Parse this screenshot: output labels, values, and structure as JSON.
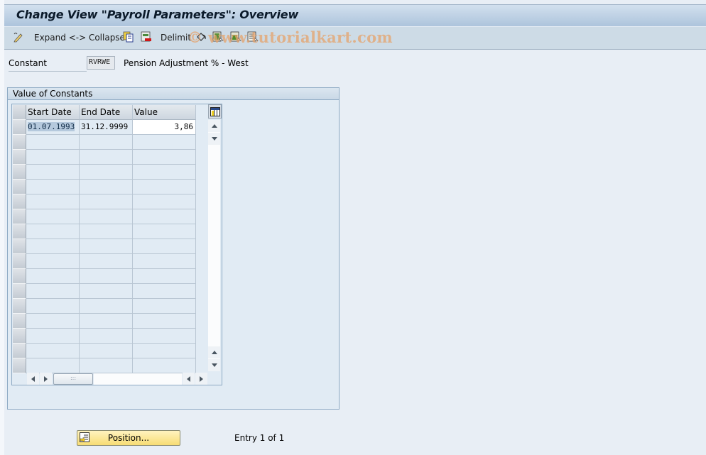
{
  "title": "Change View \"Payroll Parameters\": Overview",
  "toolbar": {
    "items": [
      {
        "icon": "edit-pencil-icon"
      },
      {
        "label": "Expand <-> Collapse"
      },
      {
        "icon": "copy-icon"
      },
      {
        "icon": "delete-row-icon"
      },
      {
        "label": "Delimit"
      },
      {
        "icon": "undo-change-icon"
      },
      {
        "icon": "select-all-icon"
      },
      {
        "icon": "select-block-icon"
      },
      {
        "icon": "deselect-all-icon"
      }
    ],
    "expand_label": "Expand <-> Collapse",
    "delimit_label": "Delimit"
  },
  "watermark": "© www.tutorialkart.com",
  "constant": {
    "label": "Constant",
    "value": "RVRWE",
    "description": "Pension Adjustment % - West"
  },
  "group": {
    "title": "Value of Constants",
    "table": {
      "columns": [
        "Start Date",
        "End Date",
        "Value"
      ],
      "rows": [
        {
          "start": "01.07.1993",
          "end": "31.12.9999",
          "value": "3,86"
        }
      ],
      "empty_rows": 16
    }
  },
  "footer": {
    "position_button": "Position...",
    "entry_text": "Entry 1 of 1"
  }
}
